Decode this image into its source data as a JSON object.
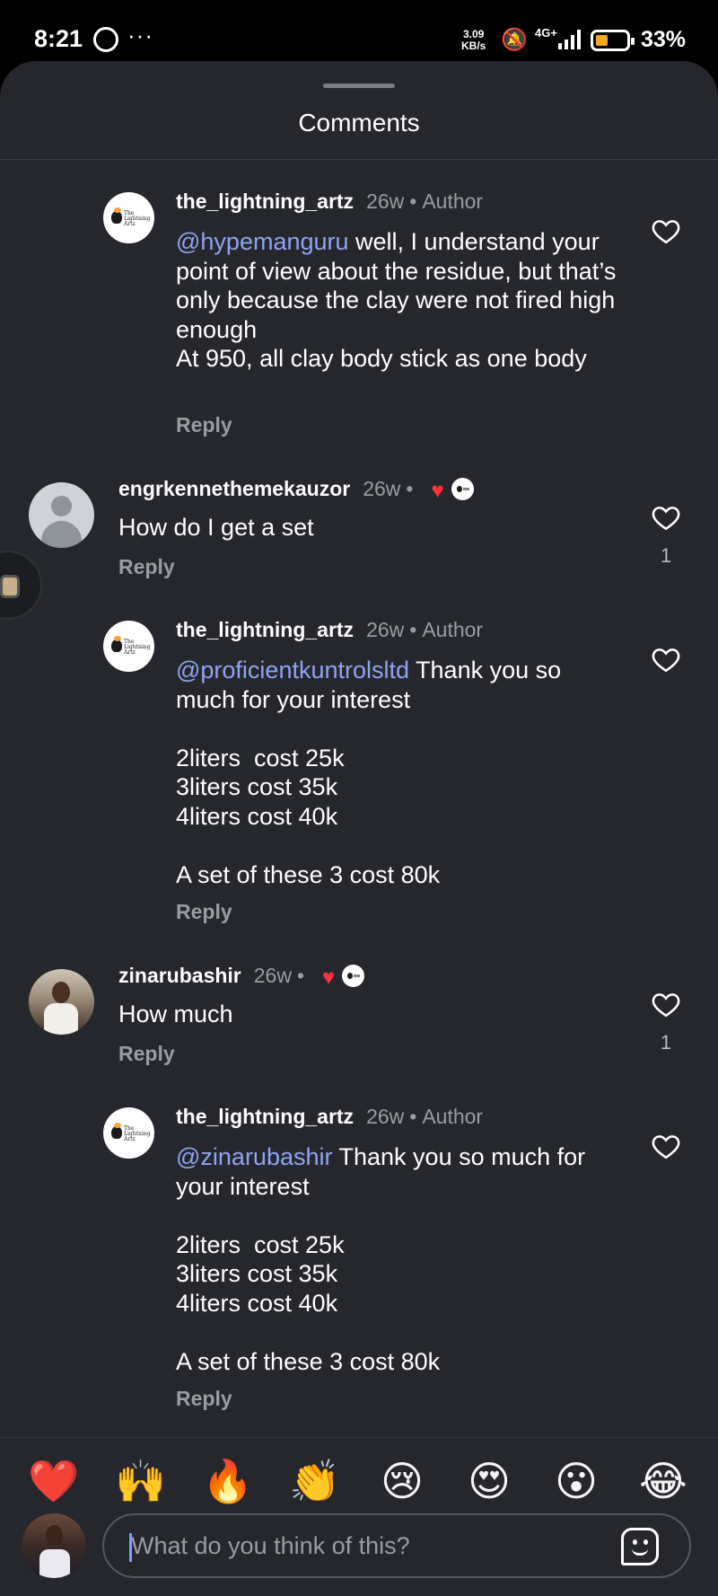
{
  "status_bar": {
    "time": "8:21",
    "speed_value": "3.09",
    "speed_unit": "KB/s",
    "network": "4G+",
    "battery": "33%",
    "battery_level": 0.33
  },
  "sheet": {
    "title": "Comments"
  },
  "comments": [
    {
      "username": "the_lightning_artz",
      "time": "26w",
      "author_tag": "Author",
      "mention": "@hypemanguru",
      "text": " well, I understand your point of view about the residue, but that’s only because the clay were not fired high enough\nAt 950, all clay body stick as one body",
      "reply_label": "Reply"
    },
    {
      "username": "engrkennethemekauzor",
      "time": "26w",
      "text": "How do I get a set",
      "reply_label": "Reply",
      "like_count": "1"
    },
    {
      "username": "the_lightning_artz",
      "time": "26w",
      "author_tag": "Author",
      "mention": "@proficientkuntrolsltd",
      "text": " Thank you so much for your interest\n\n2liters  cost 25k\n3liters cost 35k\n4liters cost 40k\n\nA set of these 3 cost 80k",
      "reply_label": "Reply"
    },
    {
      "username": "zinarubashir",
      "time": "26w",
      "text": "How much",
      "reply_label": "Reply",
      "like_count": "1"
    },
    {
      "username": "the_lightning_artz",
      "time": "26w",
      "author_tag": "Author",
      "mention": "@zinarubashir",
      "text": " Thank you so much for your interest\n\n2liters  cost 25k\n3liters cost 35k\n4liters cost 40k\n\nA set of these 3 cost 80k",
      "reply_label": "Reply"
    }
  ],
  "logo_text": "The Lightning Artz",
  "emoji_reactions": [
    "❤️",
    "🙌",
    "🔥",
    "👏",
    "😢",
    "😍",
    "😮",
    "😂"
  ],
  "composer": {
    "placeholder": "What do you think of this?"
  },
  "colors": {
    "background": "#25272c",
    "mention": "#8ea4f2",
    "like_red": "#ff3040",
    "muted": "#9a9ca2"
  }
}
